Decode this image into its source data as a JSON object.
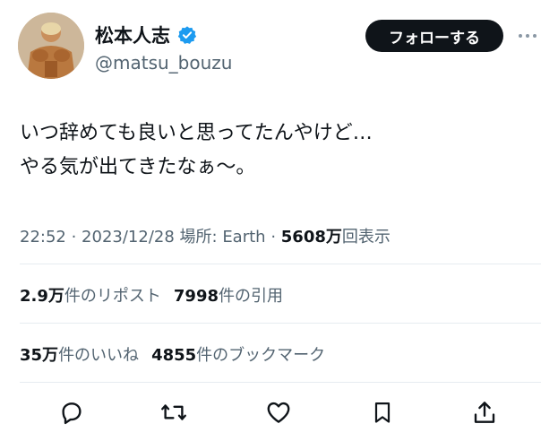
{
  "author": {
    "display_name": "松本人志",
    "handle": "@matsu_bouzu",
    "verified_icon": "verified-badge-icon",
    "avatar_icon": "avatar-muscle-figure"
  },
  "header": {
    "follow_label": "フォローする",
    "more_icon": "more-options-icon"
  },
  "tweet": {
    "lines": [
      "いつ辞めても良いと思ってたんやけど…",
      "やる気が出てきたなぁ〜。"
    ]
  },
  "meta": {
    "time": "22:52",
    "sep1": " · ",
    "date": "2023/12/28",
    "location_label": " 場所: ",
    "location": "Earth",
    "sep2": " · ",
    "views_count": "5608万",
    "views_label": "回表示"
  },
  "stats": {
    "reposts_count": "2.9万",
    "reposts_label": "件のリポスト",
    "quotes_count": "7998",
    "quotes_label": "件の引用",
    "likes_count": "35万",
    "likes_label": "件のいいね",
    "bookmarks_count": "4855",
    "bookmarks_label": "件のブックマーク"
  },
  "actions": {
    "icons": [
      "reply-icon",
      "repost-icon",
      "like-icon",
      "bookmark-icon",
      "share-icon"
    ]
  },
  "colors": {
    "text_primary": "#0f1419",
    "text_secondary": "#536471",
    "verified_blue": "#1d9bf0",
    "button_bg": "#0f1419",
    "divider": "#e6ecf0"
  }
}
